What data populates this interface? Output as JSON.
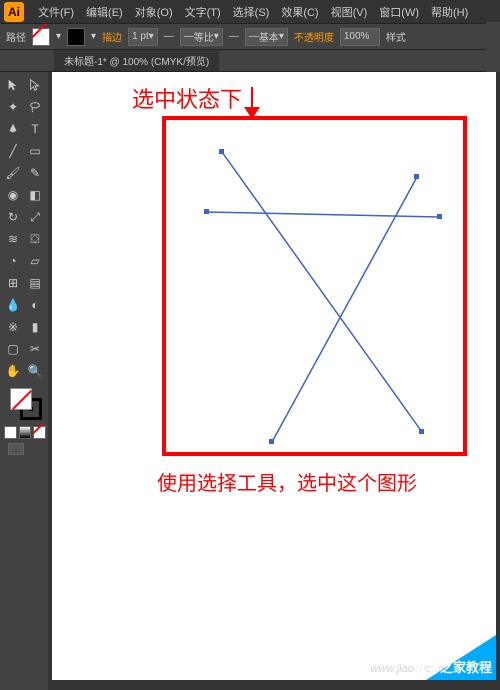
{
  "app": {
    "icon_text": "Ai"
  },
  "menu": {
    "items": [
      "文件(F)",
      "编辑(E)",
      "对象(O)",
      "文字(T)",
      "选择(S)",
      "效果(C)",
      "视图(V)",
      "窗口(W)",
      "帮助(H)"
    ]
  },
  "options": {
    "path_label": "路径",
    "stroke_label": "描边",
    "stroke_weight": "1 pt",
    "uniform_label": "等比",
    "basic_label": "基本",
    "opacity_label": "不透明度",
    "opacity_value": "100%",
    "style_label": "样式"
  },
  "document": {
    "tab_title": "未标题-1* @ 100% (CMYK/预览)"
  },
  "annotations": {
    "selected_state": "选中状态下",
    "instruction": "使用选择工具，选中这个图形"
  },
  "watermark": {
    "url": "www.jiaocheng.jb51.net",
    "brand": "脚本之家教程"
  },
  "tools": {
    "row1": [
      "selection",
      "direct-selection"
    ],
    "row2": [
      "magic-wand",
      "lasso"
    ],
    "row3": [
      "pen",
      "type"
    ],
    "row4": [
      "line",
      "rectangle"
    ],
    "row5": [
      "brush",
      "pencil"
    ],
    "row6": [
      "blob-brush",
      "eraser"
    ],
    "row7": [
      "rotate",
      "scale"
    ],
    "row8": [
      "width",
      "free-transform"
    ],
    "row9": [
      "shape-builder",
      "perspective"
    ],
    "row10": [
      "mesh",
      "gradient"
    ],
    "row11": [
      "eyedropper",
      "blend"
    ],
    "row12": [
      "symbol-sprayer",
      "graph"
    ],
    "row13": [
      "artboard",
      "slice"
    ],
    "row14": [
      "hand",
      "zoom"
    ]
  }
}
